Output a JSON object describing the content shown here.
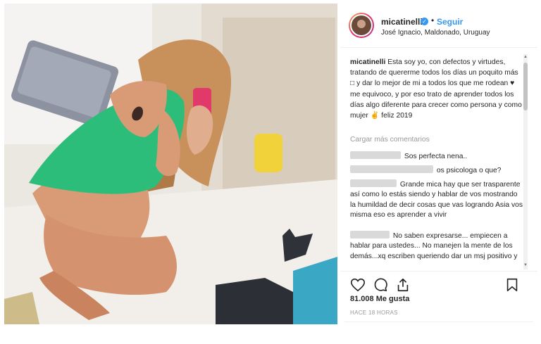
{
  "post": {
    "username": "micatinelli",
    "follow_label": "Seguir",
    "separator": "•",
    "location": "José Ignacio, Maldonado, Uruguay",
    "caption_user": "micatinelli",
    "caption_text": "Esta soy yo, con defectos y virtudes, tratando de quererme todos los días un poquito más □ y dar lo mejor de mi a todos los que me rodean ♥ me equivoco, y por eso trato de aprender todos los días algo diferente para crecer como persona y como mujer ✌ feliz 2019",
    "load_more": "Cargar más comentarios",
    "comments": [
      {
        "text": "Sos perfecta nena.."
      },
      {
        "text": "os psicologa o que?"
      },
      {
        "text": "Grande mica hay que ser trasparente así como lo estás siendo y hablar de vos mostrando la humildad de decir cosas que vas logrando Asia vos misma eso es aprender a vivir"
      },
      {
        "text": "No saben expresarse... empiecen a hablar para ustedes... No manejen la mente de los demás...xq escriben queriendo dar un msj positivo y"
      }
    ],
    "likes": "81.008 Me gusta",
    "time": "HACE 18 HORAS"
  },
  "icons": {
    "verified": "verified-badge-icon",
    "like": "heart-icon",
    "comment": "comment-icon",
    "share": "share-icon",
    "save": "bookmark-icon"
  },
  "colors": {
    "link": "#3897f0",
    "text": "#262626",
    "muted": "#999999",
    "swimsuit": "#2dbd7a"
  }
}
